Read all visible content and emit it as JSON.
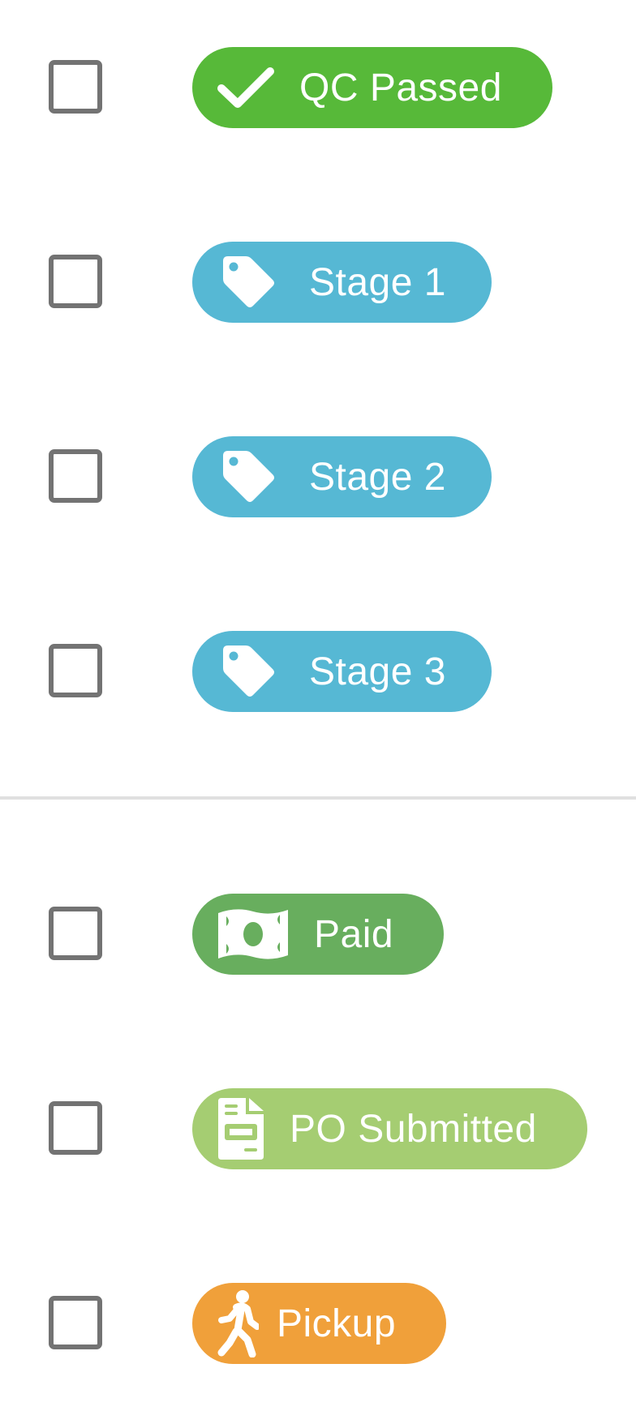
{
  "labels": {
    "items": [
      {
        "label": "QC Passed",
        "icon": "checkmark-icon",
        "color": "#57b939"
      },
      {
        "label": "Stage 1",
        "icon": "tag-icon",
        "color": "#56b8d4"
      },
      {
        "label": "Stage 2",
        "icon": "tag-icon",
        "color": "#56b8d4"
      },
      {
        "label": "Stage 3",
        "icon": "tag-icon",
        "color": "#56b8d4"
      },
      {
        "label": "Paid",
        "icon": "money-bill-icon",
        "color": "#68ae5e"
      },
      {
        "label": "PO Submitted",
        "icon": "invoice-icon",
        "color": "#a5cd72"
      },
      {
        "label": "Pickup",
        "icon": "person-walking-icon",
        "color": "#f0a03a"
      }
    ],
    "checkbox_checked": [
      false,
      false,
      false,
      false,
      false,
      false,
      false
    ]
  }
}
